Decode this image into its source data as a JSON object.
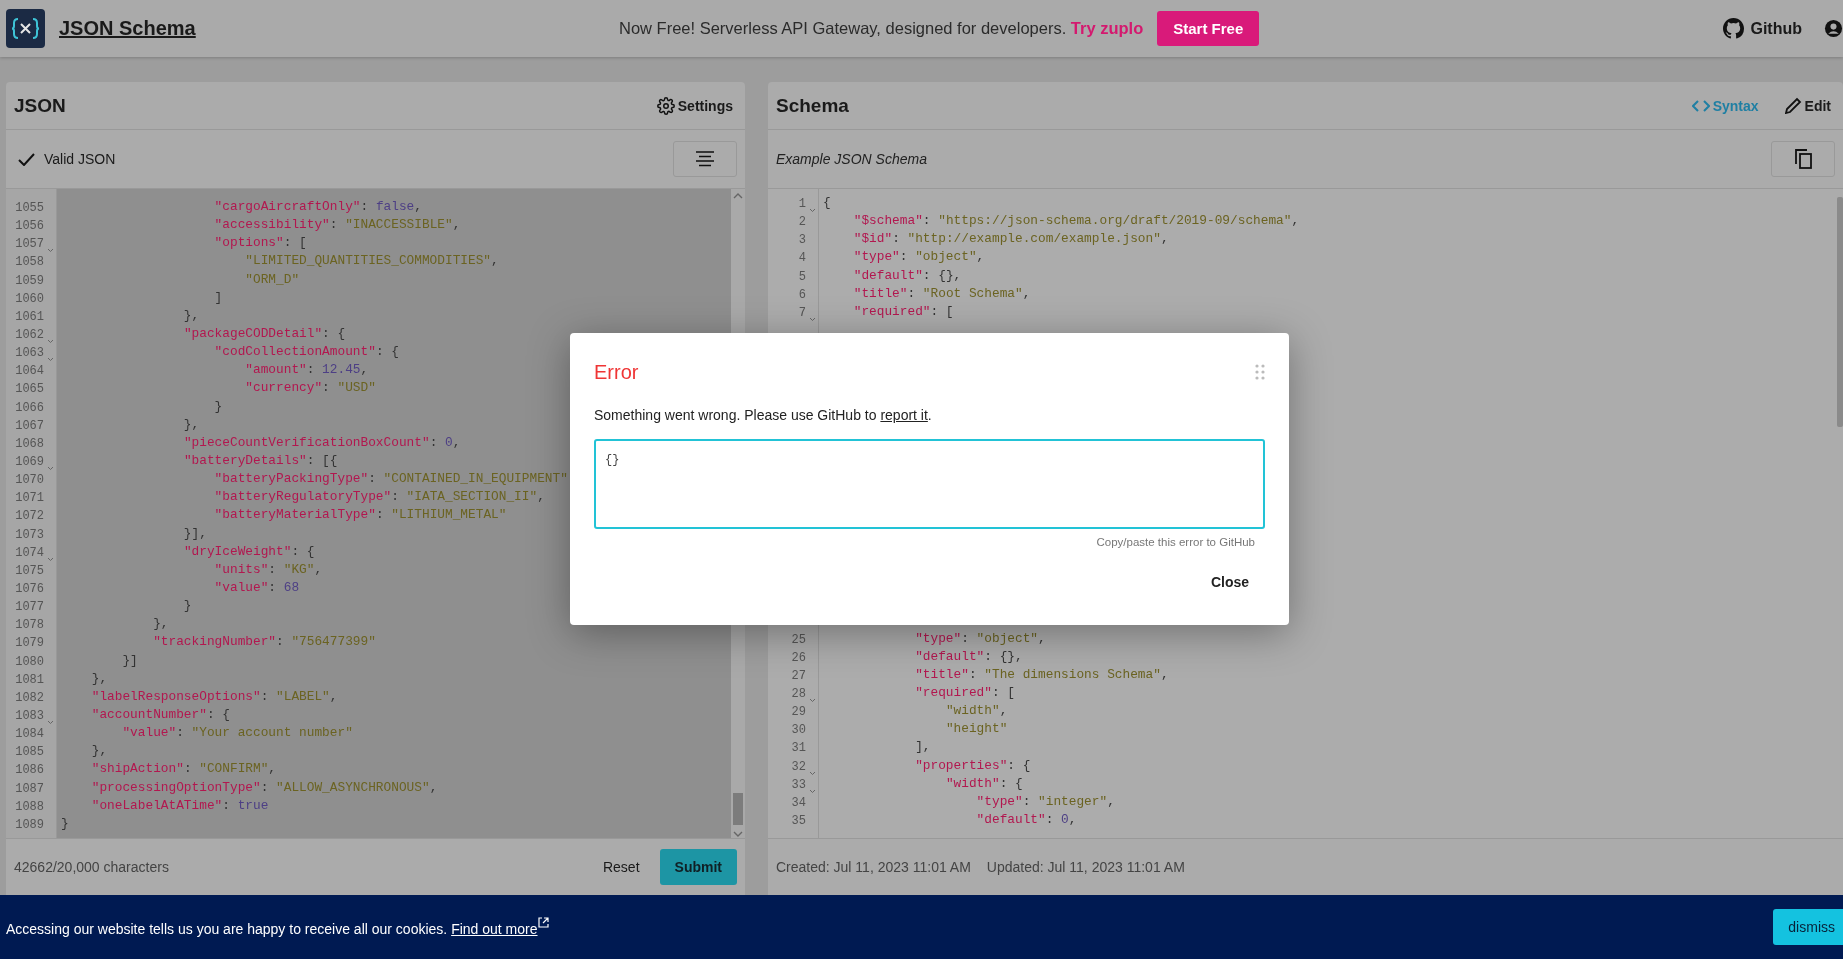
{
  "header": {
    "title": "JSON Schema",
    "promo": "Now Free! Serverless API Gateway, designed for developers.",
    "promo_link": "Try zuplo",
    "cta": "Start Free",
    "github": "Github"
  },
  "json_panel": {
    "title": "JSON",
    "settings": "Settings",
    "status": "Valid JSON",
    "char_count": "42662/20,000 characters",
    "reset": "Reset",
    "submit": "Submit",
    "lines": [
      {
        "n": "1055",
        "code": "                    \"cargoAircraftOnly\": false,",
        "fold": false
      },
      {
        "n": "1056",
        "code": "                    \"accessibility\": \"INACCESSIBLE\",",
        "fold": false
      },
      {
        "n": "1057",
        "code": "                    \"options\": [",
        "fold": true
      },
      {
        "n": "1058",
        "code": "                        \"LIMITED_QUANTITIES_COMMODITIES\",",
        "fold": false
      },
      {
        "n": "1059",
        "code": "                        \"ORM_D\"",
        "fold": false
      },
      {
        "n": "1060",
        "code": "                    ]",
        "fold": false
      },
      {
        "n": "1061",
        "code": "                },",
        "fold": false
      },
      {
        "n": "1062",
        "code": "                \"packageCODDetail\": {",
        "fold": true
      },
      {
        "n": "1063",
        "code": "                    \"codCollectionAmount\": {",
        "fold": true
      },
      {
        "n": "1064",
        "code": "                        \"amount\": 12.45,",
        "fold": false
      },
      {
        "n": "1065",
        "code": "                        \"currency\": \"USD\"",
        "fold": false
      },
      {
        "n": "1066",
        "code": "                    }",
        "fold": false
      },
      {
        "n": "1067",
        "code": "                },",
        "fold": false
      },
      {
        "n": "1068",
        "code": "                \"pieceCountVerificationBoxCount\": 0,",
        "fold": false
      },
      {
        "n": "1069",
        "code": "                \"batteryDetails\": [{",
        "fold": true
      },
      {
        "n": "1070",
        "code": "                    \"batteryPackingType\": \"CONTAINED_IN_EQUIPMENT\"",
        "fold": false
      },
      {
        "n": "1071",
        "code": "                    \"batteryRegulatoryType\": \"IATA_SECTION_II\",",
        "fold": false
      },
      {
        "n": "1072",
        "code": "                    \"batteryMaterialType\": \"LITHIUM_METAL\"",
        "fold": false
      },
      {
        "n": "1073",
        "code": "                }],",
        "fold": false
      },
      {
        "n": "1074",
        "code": "                \"dryIceWeight\": {",
        "fold": true
      },
      {
        "n": "1075",
        "code": "                    \"units\": \"KG\",",
        "fold": false
      },
      {
        "n": "1076",
        "code": "                    \"value\": 68",
        "fold": false
      },
      {
        "n": "1077",
        "code": "                }",
        "fold": false
      },
      {
        "n": "1078",
        "code": "            },",
        "fold": false
      },
      {
        "n": "1079",
        "code": "            \"trackingNumber\": \"756477399\"",
        "fold": false
      },
      {
        "n": "1080",
        "code": "        }]",
        "fold": false
      },
      {
        "n": "1081",
        "code": "    },",
        "fold": false
      },
      {
        "n": "1082",
        "code": "    \"labelResponseOptions\": \"LABEL\",",
        "fold": false
      },
      {
        "n": "1083",
        "code": "    \"accountNumber\": {",
        "fold": true
      },
      {
        "n": "1084",
        "code": "        \"value\": \"Your account number\"",
        "fold": false
      },
      {
        "n": "1085",
        "code": "    },",
        "fold": false
      },
      {
        "n": "1086",
        "code": "    \"shipAction\": \"CONFIRM\",",
        "fold": false
      },
      {
        "n": "1087",
        "code": "    \"processingOptionType\": \"ALLOW_ASYNCHRONOUS\",",
        "fold": false
      },
      {
        "n": "1088",
        "code": "    \"oneLabelAtATime\": true",
        "fold": false
      },
      {
        "n": "1089",
        "code": "}",
        "fold": false
      }
    ]
  },
  "schema_panel": {
    "title": "Schema",
    "syntax": "Syntax",
    "edit": "Edit",
    "subtitle": "Example JSON Schema",
    "created": "Created: Jul 11, 2023 11:01 AM",
    "updated": "Updated: Jul 11, 2023 11:01 AM",
    "lines": [
      {
        "n": "1",
        "code": "{",
        "fold": true
      },
      {
        "n": "2",
        "code": "    \"$schema\": \"https://json-schema.org/draft/2019-09/schema\",",
        "fold": false
      },
      {
        "n": "3",
        "code": "    \"$id\": \"http://example.com/example.json\",",
        "fold": false
      },
      {
        "n": "4",
        "code": "    \"type\": \"object\",",
        "fold": false
      },
      {
        "n": "5",
        "code": "    \"default\": {},",
        "fold": false
      },
      {
        "n": "6",
        "code": "    \"title\": \"Root Schema\",",
        "fold": false
      },
      {
        "n": "7",
        "code": "    \"required\": [",
        "fold": true
      },
      {
        "n": "25",
        "code": "            \"type\": \"object\",",
        "fold": false
      },
      {
        "n": "26",
        "code": "            \"default\": {},",
        "fold": false
      },
      {
        "n": "27",
        "code": "            \"title\": \"The dimensions Schema\",",
        "fold": false
      },
      {
        "n": "28",
        "code": "            \"required\": [",
        "fold": true
      },
      {
        "n": "29",
        "code": "                \"width\",",
        "fold": false
      },
      {
        "n": "30",
        "code": "                \"height\"",
        "fold": false
      },
      {
        "n": "31",
        "code": "            ],",
        "fold": false
      },
      {
        "n": "32",
        "code": "            \"properties\": {",
        "fold": true
      },
      {
        "n": "33",
        "code": "                \"width\": {",
        "fold": true
      },
      {
        "n": "34",
        "code": "                    \"type\": \"integer\",",
        "fold": false
      },
      {
        "n": "35",
        "code": "                    \"default\": 0,",
        "fold": false
      }
    ]
  },
  "dialog": {
    "title": "Error",
    "message_before": "Something went wrong. Please use GitHub to ",
    "link": "report it",
    "message_after": ".",
    "error_text": "{}",
    "hint": "Copy/paste this error to GitHub",
    "close": "Close"
  },
  "cookie_banner": {
    "text": "Accessing our website tells us you are happy to receive all our cookies.",
    "link": "Find out more",
    "dismiss": "dismiss"
  }
}
